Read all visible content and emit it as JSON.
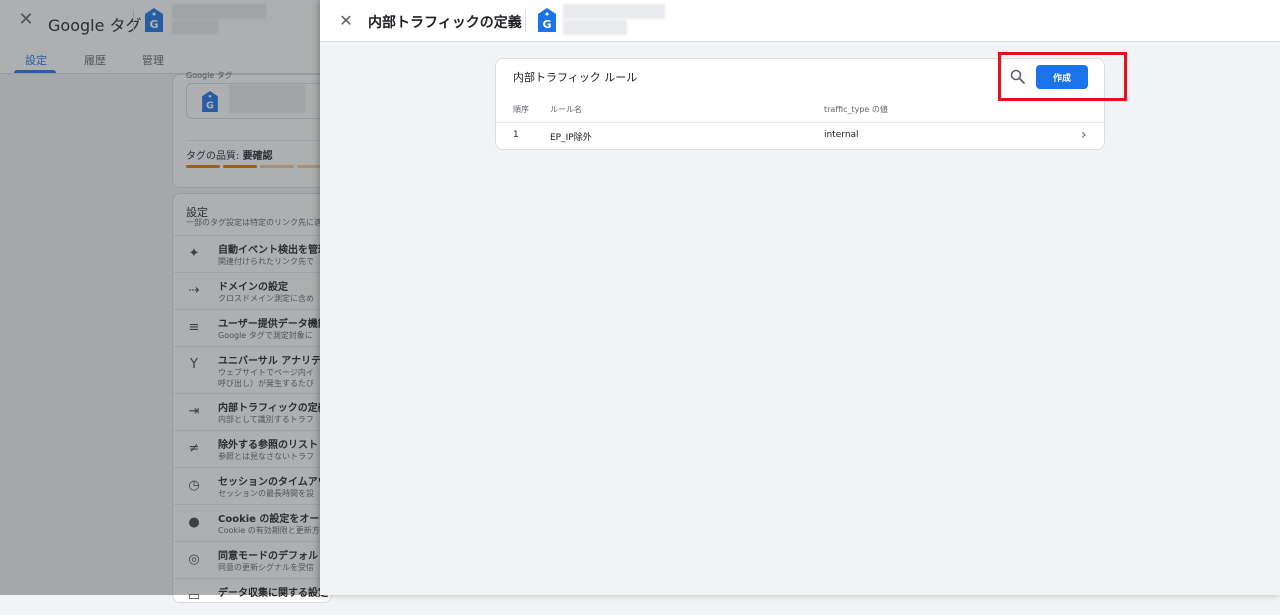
{
  "background": {
    "title": "Google タグ",
    "tabs": [
      "設定",
      "履歴",
      "管理"
    ],
    "tag_section_label": "Google タグ",
    "quality_label": "タグの品質:",
    "quality_value": "要確認",
    "settings_title": "設定",
    "settings_subtitle": "一部のタグ設定は特定のリンク先に適用",
    "rows": [
      {
        "title": "自動イベント検出を管理",
        "sub": "関連付けられたリンク先で",
        "icon": "✦"
      },
      {
        "title": "ドメインの設定",
        "sub": "クロスドメイン測定に含め",
        "icon": "⇢"
      },
      {
        "title": "ユーザー提供データ機能",
        "sub": "Google タグで測定対象に",
        "icon": "≡"
      },
      {
        "title": "ユニバーサル アナリティ",
        "sub": "ウェブサイトでページ内イ",
        "sub2": "呼び出し）が発生するたび",
        "icon": "Y"
      },
      {
        "title": "内部トラフィックの定義",
        "sub": "内部として識別するトラフ",
        "icon": "⇥"
      },
      {
        "title": "除外する参照のリスト",
        "sub": "参照とは見なさないトラフ",
        "icon": "≠"
      },
      {
        "title": "セッションのタイムアウ",
        "sub": "セッションの最長時間を設",
        "icon": "◷"
      },
      {
        "title": "Cookie の設定をオーバー",
        "sub": "Cookie の有効期限と更新方",
        "icon": "●"
      },
      {
        "title": "同意モードのデフォルト",
        "sub": "同意の更新シグナルを受信",
        "icon": "◎"
      },
      {
        "title": "データ収集に関する設定",
        "sub": "",
        "icon": "▭"
      }
    ]
  },
  "panel": {
    "title": "内部トラフィックの定義",
    "card_title": "内部トラフィック ルール",
    "create_label": "作成",
    "columns": [
      "順序",
      "ルール名",
      "traffic_type の値"
    ],
    "rows": [
      {
        "order": "1",
        "name": "EP_IP除外",
        "value": "internal"
      }
    ]
  },
  "colors": {
    "accent": "#1a73e8",
    "highlight": "#e0131a",
    "quality_orange": "#e37400"
  }
}
